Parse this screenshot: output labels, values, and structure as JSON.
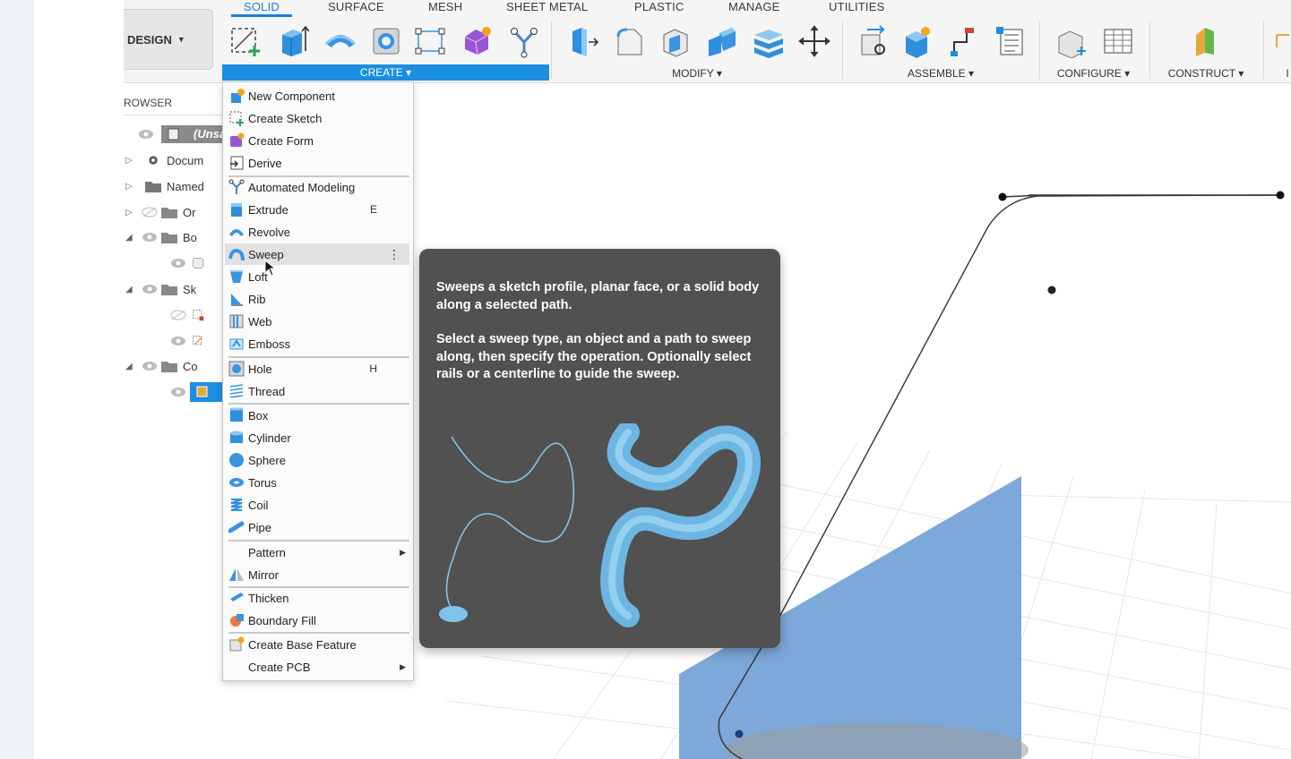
{
  "workspace": {
    "label": "DESIGN",
    "caret": "▼"
  },
  "tabs": [
    "SOLID",
    "SURFACE",
    "MESH",
    "SHEET METAL",
    "PLASTIC",
    "MANAGE",
    "UTILITIES"
  ],
  "groups": {
    "create": "CREATE ▾",
    "modify": "MODIFY ▾",
    "assemble": "ASSEMBLE ▾",
    "configure": "CONFIGURE ▾",
    "construct": "CONSTRUCT ▾",
    "partial": "I"
  },
  "browser": {
    "title": "ROWSER",
    "rows": [
      "(Unsa",
      "Docum",
      "Named",
      "Or",
      "Bo",
      "Sk",
      "Co"
    ]
  },
  "menu": {
    "items": [
      {
        "label": "New Component",
        "icon": "new-component-icon"
      },
      {
        "label": "Create Sketch",
        "icon": "create-sketch-icon"
      },
      {
        "label": "Create Form",
        "icon": "create-form-icon"
      },
      {
        "label": "Derive",
        "icon": "derive-icon"
      },
      {
        "label": "Automated Modeling",
        "icon": "automated-modeling-icon"
      },
      {
        "label": "Extrude",
        "icon": "extrude-icon",
        "shortcut": "E"
      },
      {
        "label": "Revolve",
        "icon": "revolve-icon"
      },
      {
        "label": "Sweep",
        "icon": "sweep-icon",
        "more": "⋮"
      },
      {
        "label": "Loft",
        "icon": "loft-icon"
      },
      {
        "label": "Rib",
        "icon": "rib-icon"
      },
      {
        "label": "Web",
        "icon": "web-icon"
      },
      {
        "label": "Emboss",
        "icon": "emboss-icon"
      },
      {
        "label": "Hole",
        "icon": "hole-icon",
        "shortcut": "H"
      },
      {
        "label": "Thread",
        "icon": "thread-icon"
      },
      {
        "label": "Box",
        "icon": "box-icon"
      },
      {
        "label": "Cylinder",
        "icon": "cylinder-icon"
      },
      {
        "label": "Sphere",
        "icon": "sphere-icon"
      },
      {
        "label": "Torus",
        "icon": "torus-icon"
      },
      {
        "label": "Coil",
        "icon": "coil-icon"
      },
      {
        "label": "Pipe",
        "icon": "pipe-icon"
      },
      {
        "label": "Pattern",
        "submenu": "▶"
      },
      {
        "label": "Mirror",
        "icon": "mirror-icon"
      },
      {
        "label": "Thicken",
        "icon": "thicken-icon"
      },
      {
        "label": "Boundary Fill",
        "icon": "boundary-fill-icon"
      },
      {
        "label": "Create Base Feature",
        "icon": "create-base-feature-icon"
      },
      {
        "label": "Create PCB",
        "submenu": "▶"
      }
    ]
  },
  "tooltip": {
    "line1": "Sweeps a sketch profile, planar face, or a solid body along a selected path.",
    "line2": "Select a sweep type, an object and a path to sweep along, then specify the operation. Optionally select rails or a centerline to guide the sweep."
  },
  "colors": {
    "accent": "#1b8fe0",
    "tooltip_bg": "#515151",
    "plane": "#6f9ed6",
    "sweep_tube": "#7ec4ea"
  }
}
